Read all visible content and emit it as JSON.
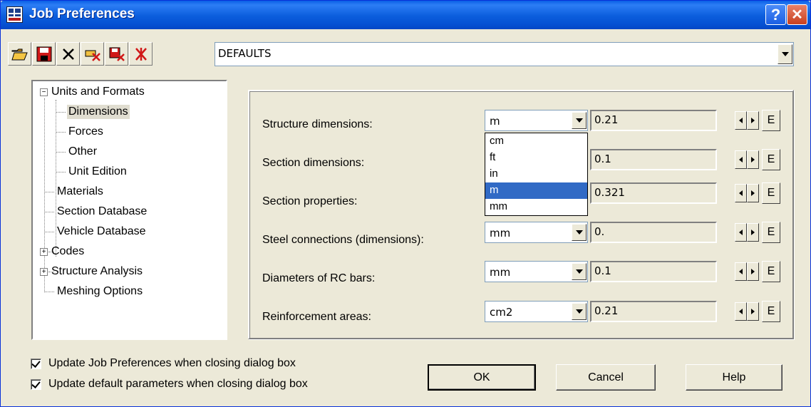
{
  "window": {
    "title": "Job Preferences",
    "help_glyph": "?",
    "close_glyph": "✕"
  },
  "toolbar": {
    "icons": [
      "open-folder-icon",
      "save-icon",
      "delete-icon",
      "delete-all-icon",
      "save-delete-icon",
      "reset-icon"
    ],
    "preset_value": "DEFAULTS"
  },
  "tree": {
    "items": [
      {
        "label": "Units and Formats",
        "level": 0,
        "expander": "minus"
      },
      {
        "label": "Dimensions",
        "level": 1,
        "selected": true
      },
      {
        "label": "Forces",
        "level": 1
      },
      {
        "label": "Other",
        "level": 1
      },
      {
        "label": "Unit Edition",
        "level": 1
      },
      {
        "label": "Materials",
        "level": 0
      },
      {
        "label": "Section Database",
        "level": 0
      },
      {
        "label": "Vehicle Database",
        "level": 0
      },
      {
        "label": "Codes",
        "level": 0,
        "expander": "plus"
      },
      {
        "label": "Structure Analysis",
        "level": 0,
        "expander": "plus"
      },
      {
        "label": "Meshing Options",
        "level": 0
      }
    ]
  },
  "rows": [
    {
      "label": "Structure dimensions:",
      "unit": "m",
      "value": "0.21"
    },
    {
      "label": "Section dimensions:",
      "unit": "",
      "value": "0.1"
    },
    {
      "label": "Section properties:",
      "unit": "",
      "value": "0.321"
    },
    {
      "label": "Steel connections (dimensions):",
      "unit": "mm",
      "value": "0."
    },
    {
      "label": "Diameters of RC bars:",
      "unit": "mm",
      "value": "0.1"
    },
    {
      "label": "Reinforcement areas:",
      "unit": "cm2",
      "value": "0.21"
    }
  ],
  "e_label": "E",
  "dropdown": {
    "options": [
      "cm",
      "ft",
      "in",
      "m",
      "mm"
    ],
    "selected": "m"
  },
  "checkboxes": [
    {
      "label": "Update Job Preferences when closing dialog box",
      "checked": true
    },
    {
      "label": "Update default parameters when closing dialog box",
      "checked": true
    }
  ],
  "buttons": {
    "ok": "OK",
    "cancel": "Cancel",
    "help": "Help"
  },
  "colors": {
    "selection": "#316ac5",
    "titlebar": "#0a5fe6",
    "face": "#ece9d8"
  }
}
